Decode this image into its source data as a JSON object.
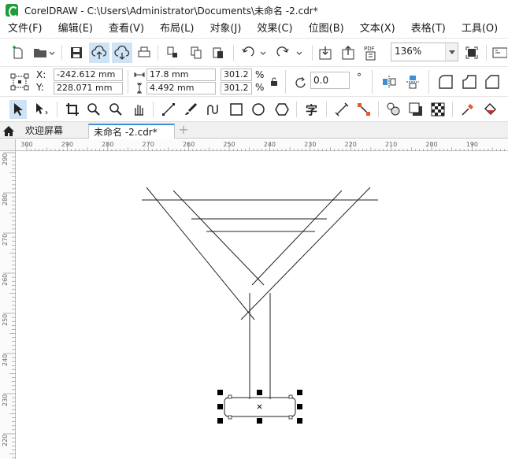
{
  "window": {
    "title": "CorelDRAW - C:\\Users\\Administrator\\Documents\\未命名 -2.cdr*"
  },
  "menu": {
    "items": [
      "文件(F)",
      "编辑(E)",
      "查看(V)",
      "布局(L)",
      "对象(J)",
      "效果(C)",
      "位图(B)",
      "文本(X)",
      "表格(T)",
      "工具(O)"
    ]
  },
  "standard_toolbar": {
    "zoom": "136%"
  },
  "property_bar": {
    "x_label": "X:",
    "x": "-242.612 mm",
    "y_label": "Y:",
    "y": "228.071 mm",
    "width": "17.8 mm",
    "height": "4.492 mm",
    "scale_x": "301.2",
    "scale_y": "301.2",
    "percent": "%",
    "rotation": "0.0",
    "degree": "°"
  },
  "tabs": {
    "welcome": "欢迎屏幕",
    "document": "未命名 -2.cdr*",
    "add": "+"
  },
  "ruler_top": {
    "labels": [
      "300",
      "290",
      "280",
      "270",
      "260",
      "250",
      "240",
      "230",
      "220",
      "210",
      "200",
      "190"
    ]
  },
  "ruler_left": {
    "labels": [
      "290",
      "280",
      "270",
      "260",
      "250",
      "240",
      "230",
      "220"
    ]
  },
  "icons": {
    "standard": [
      "new-document-icon",
      "open-icon",
      "save-icon",
      "cloud-upload-icon",
      "cloud-download-icon",
      "print-icon",
      "cut-icon",
      "copy-icon",
      "paste-icon",
      "undo-icon",
      "redo-icon",
      "import-icon",
      "export-icon",
      "publish-pdf-icon",
      "full-screen-icon",
      "options-icon"
    ],
    "tools": [
      "pick-tool-icon",
      "shape-tool-icon",
      "crop-tool-icon",
      "zoom-tool-icon",
      "pan-tool-icon",
      "freehand-tool-icon",
      "artistic-media-icon",
      "rectangle-tool-icon",
      "ellipse-tool-icon",
      "polygon-tool-icon",
      "text-tool-icon",
      "parallel-dimension-icon",
      "connector-tool-icon",
      "blend-tool-icon",
      "drop-shadow-icon",
      "transparency-icon",
      "eyedropper-icon",
      "fill-icon"
    ]
  }
}
